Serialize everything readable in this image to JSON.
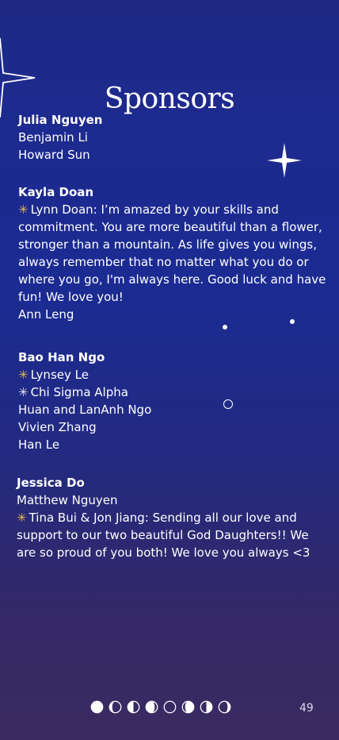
{
  "page": {
    "title": "Sponsors",
    "page_number": "49"
  },
  "sections": [
    {
      "name": "Julia Nguyen",
      "lines": [
        {
          "icon": "",
          "text": "Benjamin Li"
        },
        {
          "icon": "",
          "text": "Howard Sun"
        }
      ]
    },
    {
      "name": "Kayla Doan",
      "lines": [
        {
          "icon": "gold-star-icon",
          "text": "Lynn Doan: I’m amazed by your skills and commitment. You are more beautiful than a flower, stronger than a mountain. As life gives you wings, always remember that no matter what you do or where you go, I'm always here. Good luck and have fun! We love you!"
        },
        {
          "icon": "",
          "text": "Ann Leng"
        }
      ]
    },
    {
      "name": "Bao Han Ngo",
      "lines": [
        {
          "icon": "gold-star-icon",
          "text": "Lynsey Le"
        },
        {
          "icon": "silver-star-icon",
          "text": "Chi Sigma Alpha"
        },
        {
          "icon": "",
          "text": "Huan and LanAnh Ngo"
        },
        {
          "icon": "",
          "text": "Vivien Zhang"
        },
        {
          "icon": "",
          "text": "Han Le"
        }
      ]
    },
    {
      "name": "Jessica Do",
      "lines": [
        {
          "icon": "",
          "text": "Matthew Nguyen"
        },
        {
          "icon": "gold-star-icon",
          "text": "Tina Bui & Jon Jiang: Sending all our love and support to our two beautiful God Daughters!! We are so proud of you both! We love you always <3"
        }
      ]
    }
  ],
  "moon_phases": [
    "full",
    "waning-gibbous",
    "last-quarter",
    "waning-crescent",
    "new",
    "waxing-crescent",
    "first-quarter",
    "waxing-gibbous"
  ]
}
